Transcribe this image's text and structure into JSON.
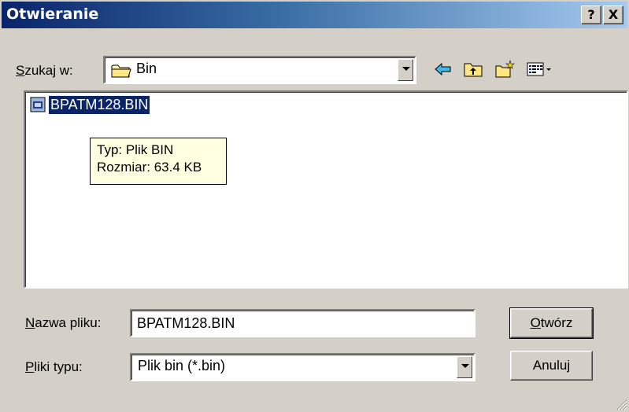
{
  "window": {
    "title": "Otwieranie",
    "help_label": "?",
    "close_label": "X"
  },
  "look_in": {
    "label": "Szukaj w:",
    "label_accel": "S",
    "label_rest": "zukaj w:",
    "value": "Bin",
    "icons": [
      "folder-icon"
    ]
  },
  "toolbar": {
    "icons": [
      "back-arrow-icon",
      "up-one-level-icon",
      "new-folder-icon",
      "view-menu-icon"
    ]
  },
  "file_list": {
    "items": [
      {
        "name": "BPATM128.BIN",
        "icon": "bin-file-icon",
        "selected": true
      }
    ]
  },
  "tooltip": {
    "type_line": "Typ: Plik BIN",
    "size_line": "Rozmiar: 63.4 KB"
  },
  "file_name": {
    "label_accel": "N",
    "label_rest": "azwa pliku:",
    "value": "BPATM128.BIN"
  },
  "file_type": {
    "label_accel": "P",
    "label_rest": "liki typu:",
    "value": "Plik bin (*.bin)"
  },
  "buttons": {
    "open_accel": "O",
    "open_rest": "twórz",
    "cancel_label": "Anuluj"
  },
  "colors": {
    "titlebar_start": "#0a246a",
    "titlebar_end": "#a6caf0",
    "dialog_bg": "#d4d0c8",
    "selection": "#0a246a",
    "tooltip_bg": "#ffffe1"
  }
}
